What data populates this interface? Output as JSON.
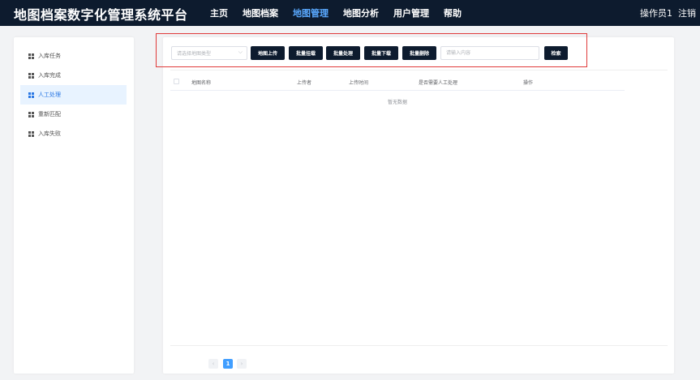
{
  "app": {
    "title": "地图档案数字化管理系统平台"
  },
  "nav": {
    "items": [
      {
        "label": "主页"
      },
      {
        "label": "地图档案"
      },
      {
        "label": "地图管理"
      },
      {
        "label": "地图分析"
      },
      {
        "label": "用户管理"
      },
      {
        "label": "帮助"
      }
    ],
    "active_index": 2
  },
  "user": {
    "name": "操作员1",
    "logout_label": "注销"
  },
  "sidebar": {
    "items": [
      {
        "label": "入库任务"
      },
      {
        "label": "入库完成"
      },
      {
        "label": "人工处理"
      },
      {
        "label": "重新匹配"
      },
      {
        "label": "入库失败"
      }
    ],
    "active_index": 2
  },
  "toolbar": {
    "type_select_placeholder": "请选择地图类型",
    "upload_label": "地图上传",
    "batch_mount_label": "批量挂载",
    "batch_process_label": "批量处理",
    "batch_download_label": "批量下载",
    "batch_delete_label": "批量删除",
    "search_placeholder": "请输入内容",
    "search_button_label": "检索"
  },
  "table": {
    "columns": [
      "地图名称",
      "上传者",
      "上传时间",
      "是否需要人工处理",
      "操作"
    ],
    "rows": [],
    "empty_text": "暂无数据"
  },
  "pagination": {
    "prev": "‹",
    "current_page": "1",
    "next": "›"
  },
  "colors": {
    "topbar": "#0d1b2e",
    "active_nav": "#5aa9ff",
    "accent": "#409eff",
    "highlight_border": "#e03a3a"
  }
}
